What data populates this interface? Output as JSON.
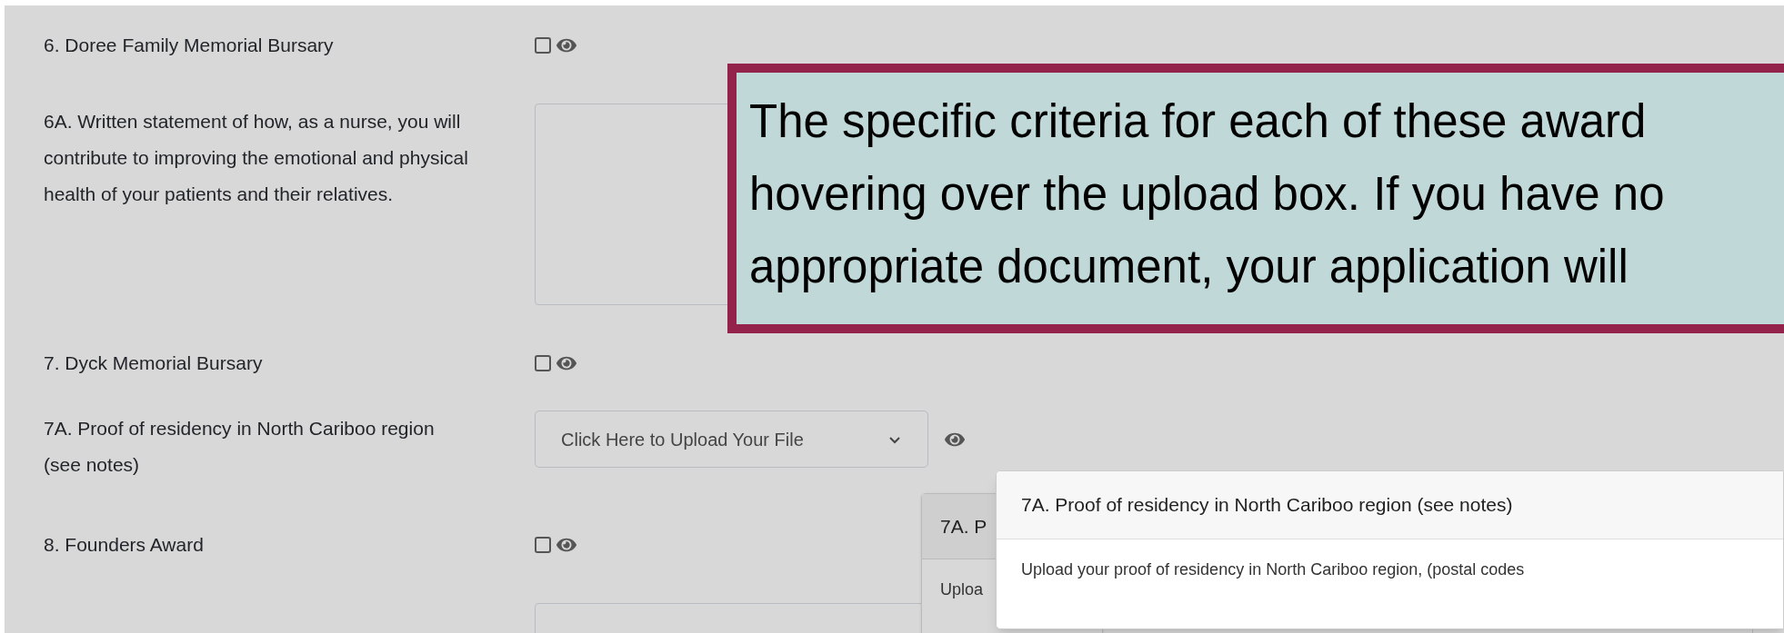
{
  "rows": [
    {
      "kind": "checkbox",
      "label": "6. Doree Family Memorial Bursary",
      "checked": false
    },
    {
      "kind": "textarea",
      "label": "6A. Written statement of how, as a nurse, you will contribute to improving the emotional and physical health of your patients and their relatives."
    },
    {
      "kind": "checkbox",
      "label": "7. Dyck Memorial Bursary",
      "checked": false
    },
    {
      "kind": "upload",
      "label": "7A. Proof of residency in North Cariboo region (see notes)",
      "value": "Click Here to Upload Your File"
    },
    {
      "kind": "checkbox",
      "label": "8. Founders Award",
      "checked": false
    },
    {
      "kind": "textarea"
    }
  ],
  "popovers": [
    {
      "header": "7A. P",
      "body": "Uploa"
    },
    {
      "header": "7A. Proof of residency in North Cariboo region (see notes)",
      "body": "Upload your proof of residency in North Cariboo region, (postal codes"
    }
  ],
  "callout": {
    "lines": [
      "The specific criteria for each of these award",
      "hovering over the upload box. If you have no",
      "appropriate document, your application will"
    ]
  }
}
